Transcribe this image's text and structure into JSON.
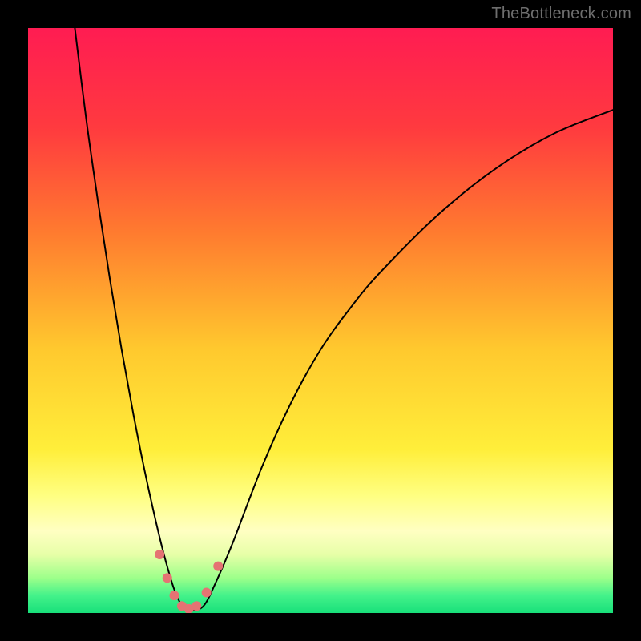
{
  "watermark": "TheBottleneck.com",
  "chart_data": {
    "type": "line",
    "title": "",
    "xlabel": "",
    "ylabel": "",
    "xlim": [
      0,
      100
    ],
    "ylim": [
      0,
      100
    ],
    "gradient_stops": [
      {
        "offset": 0,
        "color": "#ff1c52"
      },
      {
        "offset": 0.17,
        "color": "#ff3a3f"
      },
      {
        "offset": 0.35,
        "color": "#ff7b2f"
      },
      {
        "offset": 0.55,
        "color": "#ffc92e"
      },
      {
        "offset": 0.72,
        "color": "#ffee3a"
      },
      {
        "offset": 0.8,
        "color": "#ffff82"
      },
      {
        "offset": 0.86,
        "color": "#ffffc2"
      },
      {
        "offset": 0.9,
        "color": "#e7ffa8"
      },
      {
        "offset": 0.94,
        "color": "#9dff8a"
      },
      {
        "offset": 0.97,
        "color": "#44f28a"
      },
      {
        "offset": 1.0,
        "color": "#18e07a"
      }
    ],
    "series": [
      {
        "name": "curve",
        "stroke": "#000000",
        "stroke_width": 2,
        "x": [
          8,
          10,
          12,
          14,
          16,
          18,
          20,
          22,
          23.5,
          25,
          26.5,
          28,
          30,
          32,
          35,
          40,
          45,
          50,
          55,
          60,
          70,
          80,
          90,
          100
        ],
        "y": [
          100,
          84,
          70,
          57,
          45,
          34,
          24,
          15,
          9,
          4,
          1,
          0.5,
          1.2,
          5,
          12,
          25,
          36,
          45,
          52,
          58,
          68,
          76,
          82,
          86
        ]
      }
    ],
    "markers": {
      "color": "#e57373",
      "radius": 6,
      "points": [
        {
          "x": 22.5,
          "y": 10
        },
        {
          "x": 23.8,
          "y": 6
        },
        {
          "x": 25.0,
          "y": 3
        },
        {
          "x": 26.3,
          "y": 1.2
        },
        {
          "x": 27.5,
          "y": 0.7
        },
        {
          "x": 28.8,
          "y": 1.2
        },
        {
          "x": 30.5,
          "y": 3.5
        },
        {
          "x": 32.5,
          "y": 8
        }
      ]
    }
  }
}
